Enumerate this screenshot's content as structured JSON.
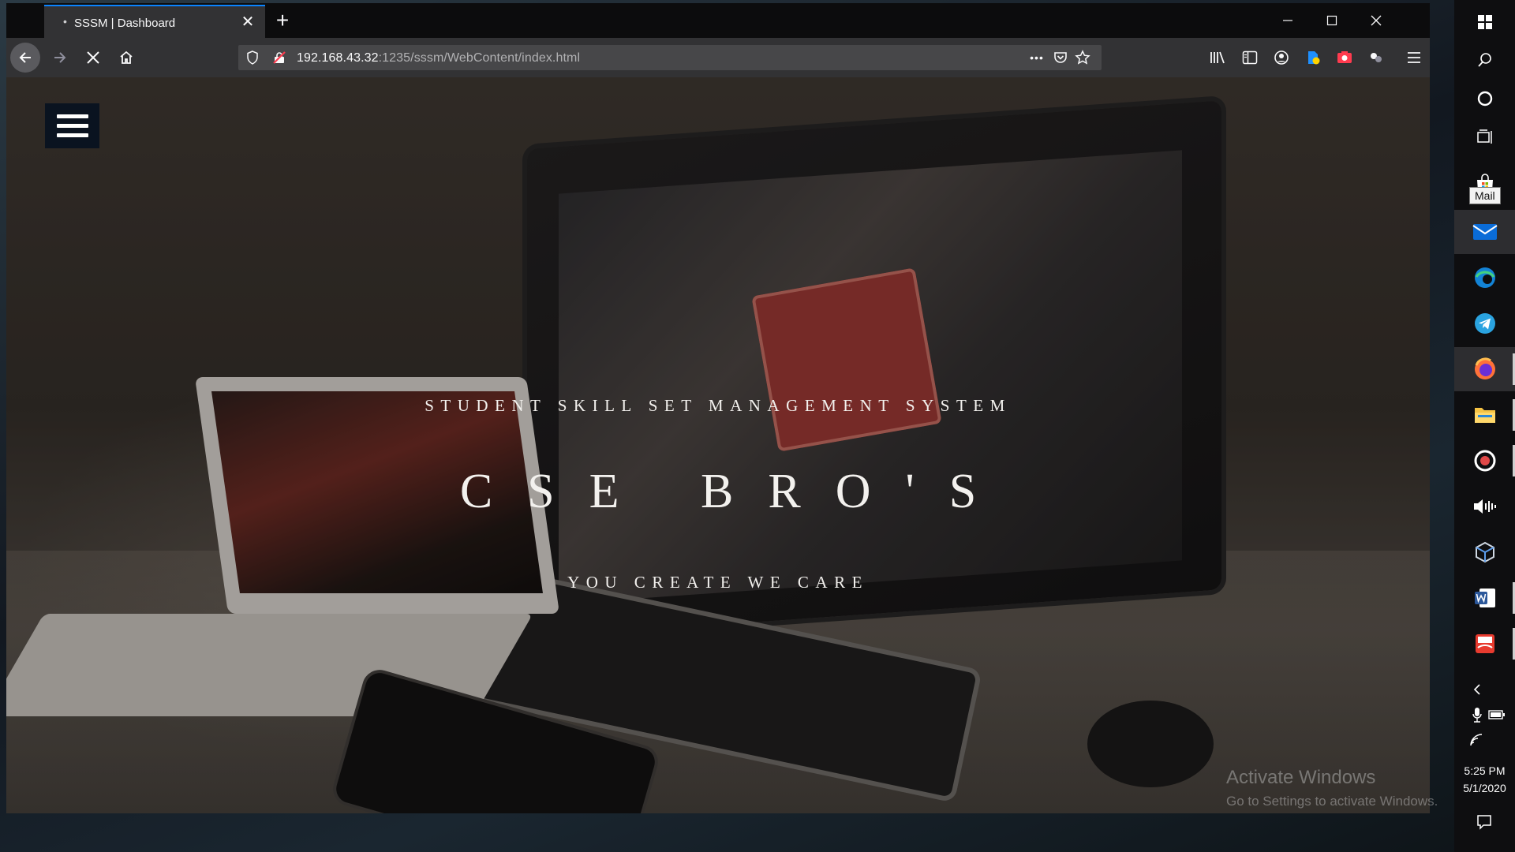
{
  "browser": {
    "tab": {
      "title": "SSSM | Dashboard",
      "close_glyph": "✕"
    },
    "new_tab_glyph": "+",
    "url": {
      "host": "192.168.43.32",
      "path": ":1235/sssm/WebContent/index.html"
    },
    "page_actions_glyph": "•••"
  },
  "page": {
    "subtitle": "STUDENT SKILL SET MANAGEMENT SYSTEM",
    "title": "CSE BRO'S",
    "tagline": "YOU CREATE WE CARE"
  },
  "watermark": {
    "line1": "Activate Windows",
    "line2": "Go to Settings to activate Windows."
  },
  "taskbar": {
    "tooltip": "Mail",
    "time": "5:25 PM",
    "date": "5/1/2020",
    "pinned": [
      "windows-start-icon",
      "search-icon",
      "cortana-icon",
      "task-view-icon",
      "store-icon",
      "mail-icon",
      "edge-icon",
      "telegram-icon",
      "firefox-icon",
      "file-explorer-icon",
      "media-icon",
      "audio-icon",
      "virtualbox-icon",
      "word-icon",
      "app-icon"
    ]
  },
  "colors": {
    "accent": "#0a84ff",
    "menu_button": "#0a1320",
    "toolbar": "#323234",
    "tab_strip": "#0c0c0d"
  }
}
